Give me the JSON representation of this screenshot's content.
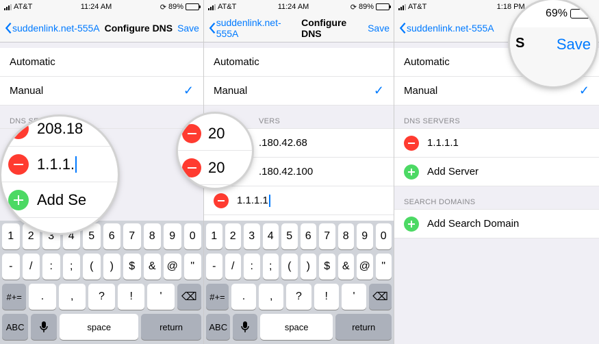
{
  "status": {
    "carrier": "AT&T",
    "time12": "11:24 AM",
    "time13": "1:18 PM",
    "batt_pct": "89%",
    "batt_pct_zoom": "69%"
  },
  "nav": {
    "back_label": "suddenlink.net-555A",
    "title": "Configure DNS",
    "save": "Save"
  },
  "mode": {
    "automatic": "Automatic",
    "manual": "Manual"
  },
  "groups": {
    "dns": "DNS SERVERS",
    "search": "SEARCH DOMAINS"
  },
  "dns": {
    "ip1": "208.18",
    "ip2": "1.1.1.1",
    "addServer": "Add Server",
    "svr1": ".180.42.68",
    "svr2": ".180.42.100",
    "input": "1.1.1.1"
  },
  "search": {
    "addDomain": "Add Search Domain"
  },
  "zoom1": {
    "t1": "208.18",
    "t2": "1.1.1.",
    "t3": "Add Se"
  },
  "zoom2": {
    "t1": "20",
    "t2": "20"
  },
  "zoom3": {
    "s": "S",
    "save": "Save"
  },
  "kb": {
    "r1": [
      "1",
      "2",
      "3",
      "4",
      "5",
      "6",
      "7",
      "8",
      "9",
      "0"
    ],
    "r2": [
      "-",
      "/",
      ":",
      ";",
      "(",
      ")",
      "$",
      "&",
      "@",
      "\""
    ],
    "sym": "#+=",
    "r3": [
      ".",
      ",",
      "?",
      "!",
      "'"
    ],
    "abc": "ABC",
    "space": "space",
    "return": "return"
  }
}
